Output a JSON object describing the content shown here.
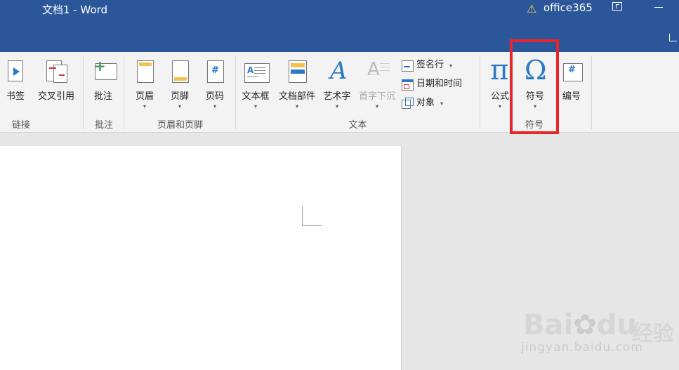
{
  "titlebar": {
    "title": "文档1  -  Word",
    "account": "office365",
    "warn_icon": "warning-icon"
  },
  "ribbon": {
    "buttons": {
      "bookmark": "书签",
      "crossref": "交叉引用",
      "comment": "批注",
      "header": "页眉",
      "footer": "页脚",
      "pagenum": "页码",
      "textbox": "文本框",
      "quickparts": "文档部件",
      "wordart": "艺术字",
      "dropcap": "首字下沉",
      "signature": "签名行",
      "datetime": "日期和时间",
      "object": "对象",
      "equation": "公式",
      "symbol": "符号",
      "number": "编号"
    },
    "groups": {
      "links": "链接",
      "comments": "批注",
      "header_footer": "页眉和页脚",
      "text": "文本",
      "symbols": "符号"
    },
    "caret": "▾"
  },
  "watermark": {
    "brand": "Bai",
    "brand2": "du",
    "suffix": "经验",
    "url": "jingyan.baidu.com"
  }
}
